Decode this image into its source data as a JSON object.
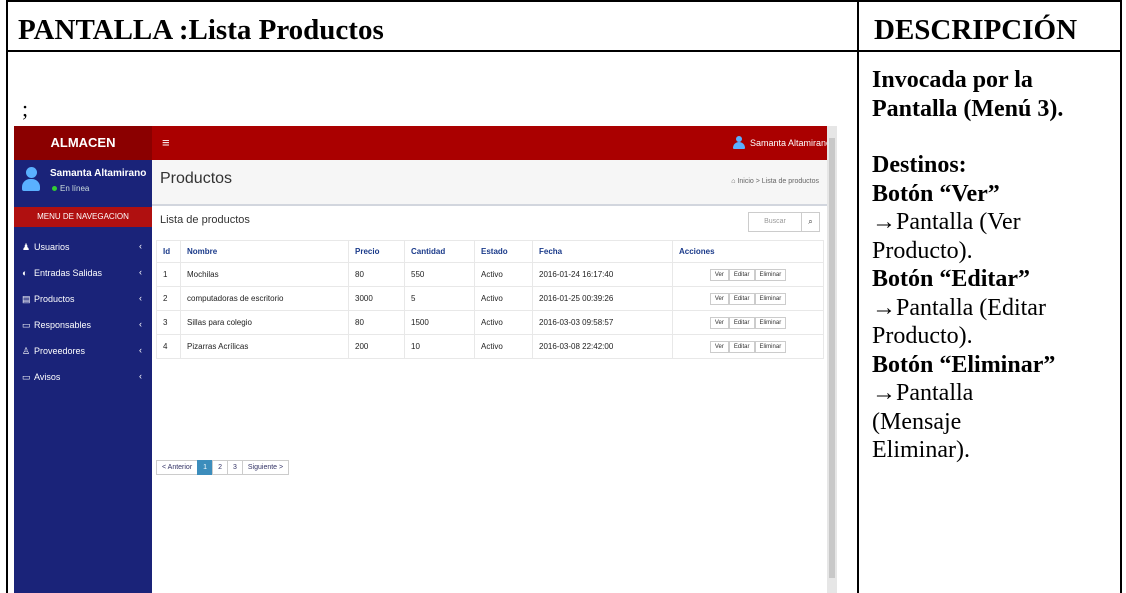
{
  "document": {
    "header_left": "PANTALLA :Lista Productos",
    "header_right": "DESCRIPCIÓN",
    "stray_mark": ";",
    "description": {
      "line1": "Invocada por la",
      "line2": "Pantalla (Menú 3).",
      "destinos": "Destinos:",
      "ver_label": "Botón “Ver”",
      "ver_arrow_line": "→Pantalla (Ver",
      "ver_line2": "Producto).",
      "editar_label": "Botón “Editar”",
      "editar_arrow_line": "→Pantalla (Editar",
      "editar_line2": "Producto).",
      "eliminar_label": "Botón “Eliminar”",
      "eliminar_arrow_line": "→Pantalla",
      "eliminar_line2": "(Mensaje",
      "eliminar_line3": "Eliminar)."
    }
  },
  "app": {
    "brand": "ALMACEN",
    "menu_icon": "≡",
    "top_user": "Samanta Altamirano",
    "sidebar": {
      "user_name": "Samanta Altamirano",
      "status": "En línea",
      "nav_header": "MENU DE NAVEGACION",
      "items": [
        {
          "icon": "♟",
          "label": "Usuarios"
        },
        {
          "icon": "◐",
          "label": "Entradas Salidas"
        },
        {
          "icon": "▤",
          "label": "Productos"
        },
        {
          "icon": "▭",
          "label": "Responsables"
        },
        {
          "icon": "♙",
          "label": "Proveedores"
        },
        {
          "icon": "▭",
          "label": "Avisos"
        }
      ]
    },
    "page_title": "Productos",
    "breadcrumb": "Inicio > Lista de productos",
    "box_title": "Lista de productos",
    "search_placeholder": "Buscar",
    "table": {
      "headers": [
        "Id",
        "Nombre",
        "Precio",
        "Cantidad",
        "Estado",
        "Fecha",
        "Acciones"
      ],
      "rows": [
        [
          "1",
          "Mochilas",
          "80",
          "550",
          "Activo",
          "2016-01-24 16:17:40"
        ],
        [
          "2",
          "computadoras de escritorio",
          "3000",
          "5",
          "Activo",
          "2016-01-25 00:39:26"
        ],
        [
          "3",
          "Sillas para colegio",
          "80",
          "1500",
          "Activo",
          "2016-03-03 09:58:57"
        ],
        [
          "4",
          "Pizarras Acrílicas",
          "200",
          "10",
          "Activo",
          "2016-03-08 22:42:00"
        ]
      ],
      "actions": [
        "Ver",
        "Editar",
        "Eliminar"
      ]
    },
    "pagination": {
      "prev": "< Anterior",
      "pages": [
        "1",
        "2",
        "3"
      ],
      "next": "Siguiente >"
    }
  }
}
